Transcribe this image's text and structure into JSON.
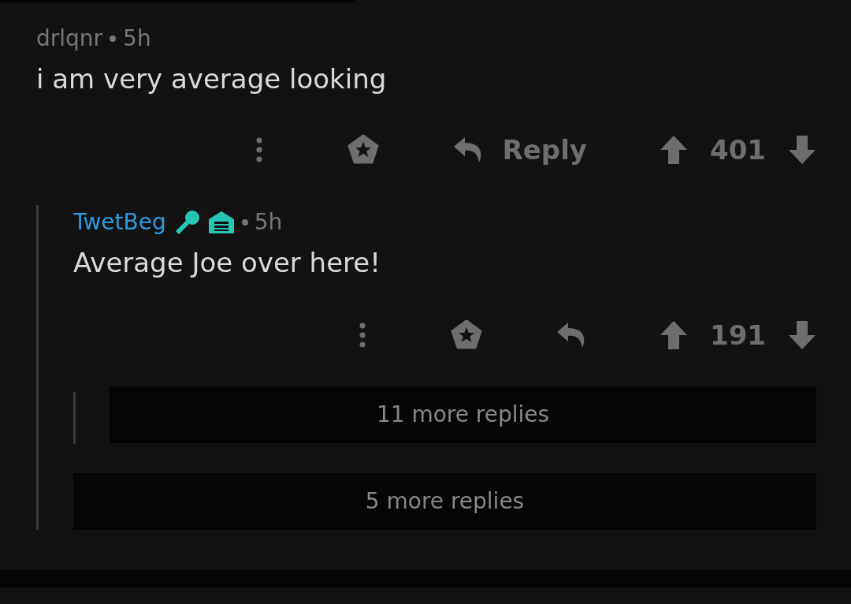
{
  "comment": {
    "author": "drlqnr",
    "time": "5h",
    "body": "i am very average looking",
    "reply_label": "Reply",
    "score": "401",
    "replies": [
      {
        "author": "TwetBeg",
        "time": "5h",
        "body": "Average Joe over here!",
        "score": "191",
        "more_replies": "11 more replies"
      }
    ],
    "more_replies": "5 more replies"
  }
}
